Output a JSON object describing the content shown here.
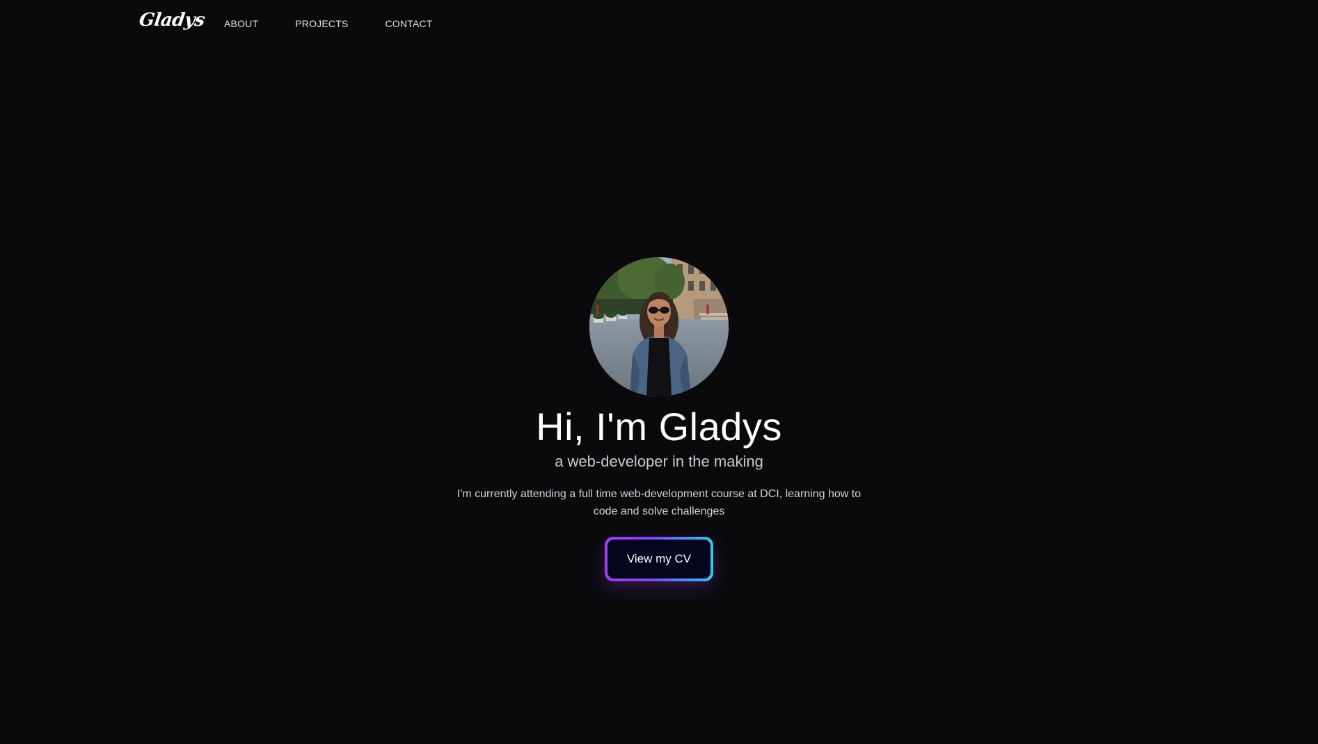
{
  "nav": {
    "logo": "Gladys",
    "links": [
      {
        "label": "ABOUT"
      },
      {
        "label": "PROJECTS"
      },
      {
        "label": "CONTACT"
      }
    ]
  },
  "hero": {
    "avatar_alt": "profile photo",
    "title": "Hi, I'm Gladys",
    "subtitle": "a web-developer in the making",
    "description": "I'm currently attending a full time web-development course at DCI, learning how to code and solve challenges",
    "cv_button_label": "View my CV"
  },
  "colors": {
    "background": "#0a0a0d",
    "button_fill": "#05051e",
    "gradient_start": "#a53df0",
    "gradient_end": "#2fc9f0"
  }
}
